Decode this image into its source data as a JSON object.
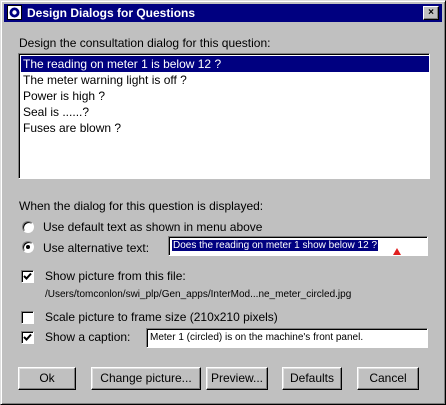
{
  "window": {
    "title": "Design Dialogs for Questions",
    "close_glyph": "×"
  },
  "list_section": {
    "label": "Design the consultation dialog for this question:",
    "items": [
      "The reading on meter 1 is below 12 ?",
      "The meter warning light is off ?",
      "Power is high ?",
      "Seal is ......?",
      "Fuses are blown ?"
    ],
    "selected_index": 0
  },
  "display_section": {
    "label": "When the dialog for this question is displayed:",
    "radio_default_label": "Use default text as shown in menu above",
    "radio_alternative_label": "Use alternative text:",
    "selected_option": "alternative",
    "alternative_text_value": "Does the reading on meter 1 show below 12 ?"
  },
  "picture_section": {
    "show_picture_label": "Show picture from this file:",
    "show_picture_checked": true,
    "file_path": "/Users/tomconlon/swi_plp/Gen_apps/InterMod...ne_meter_circled.jpg",
    "scale_label": "Scale picture to frame size (210x210 pixels)",
    "scale_checked": false,
    "caption_label": "Show a caption:",
    "caption_checked": true,
    "caption_value": "Meter 1 (circled) is on the machine's front panel."
  },
  "buttons": {
    "ok": "Ok",
    "change_picture": "Change picture...",
    "preview": "Preview...",
    "defaults": "Defaults",
    "cancel": "Cancel"
  },
  "colors": {
    "title_bar": "#000080",
    "selection": "#000080",
    "dialog_face": "#c0c0c0",
    "caret_marker": "#e02020"
  },
  "icons": {
    "title": "app-logo-icon",
    "close": "close-icon",
    "checkmark": "checkmark-icon"
  }
}
